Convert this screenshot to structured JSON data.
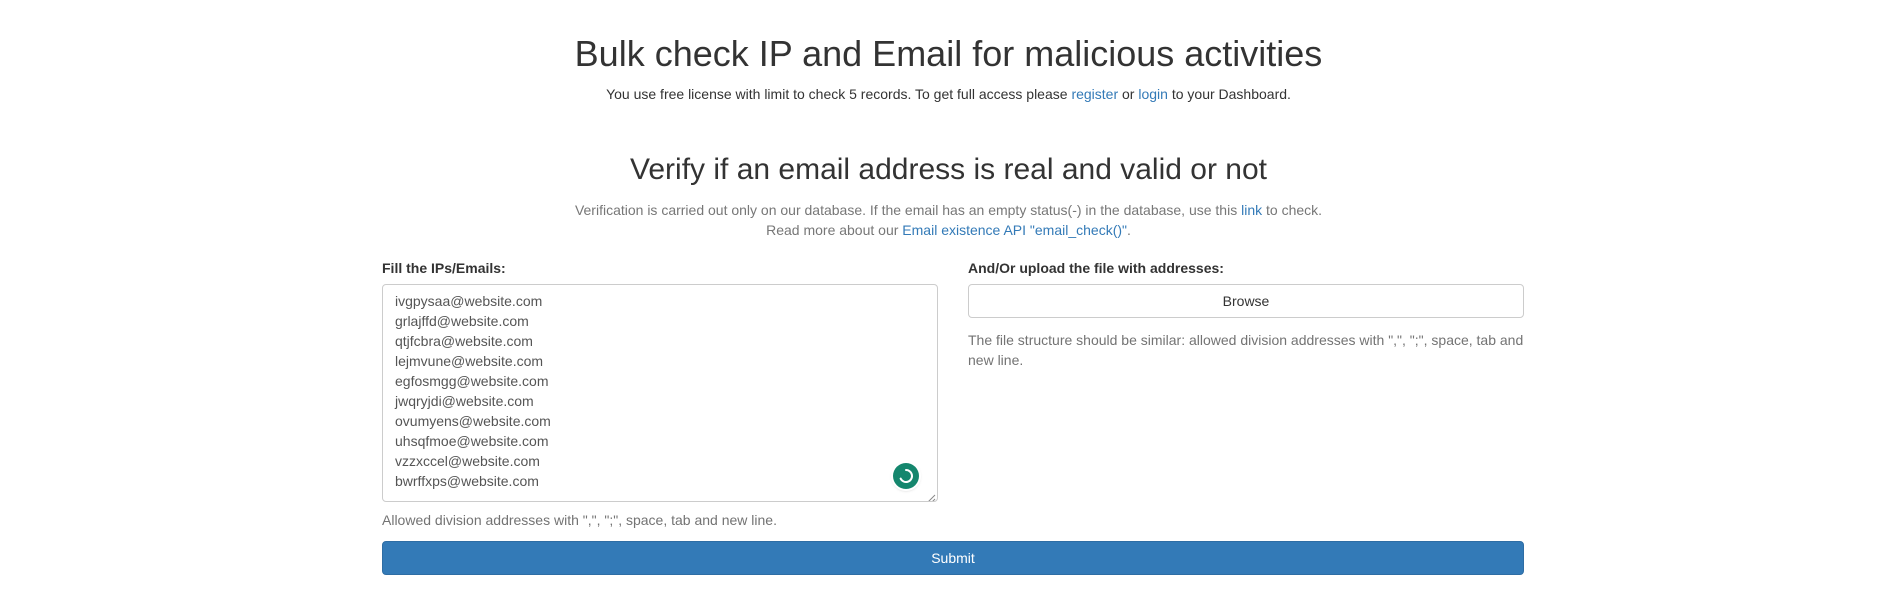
{
  "header": {
    "title": "Bulk check IP and Email for malicious activities",
    "license_prefix": "You use free license with limit to check 5 records. To get full access please ",
    "register_link": "register",
    "or_text": " or ",
    "login_link": "login",
    "license_suffix": " to your Dashboard."
  },
  "verify": {
    "title": "Verify if an email address is real and valid or not",
    "desc_prefix": "Verification is carried out only on our database. If the email has an empty status(-) in the database, use this ",
    "desc_link": "link",
    "desc_suffix": " to check.",
    "readmore_prefix": "Read more about our ",
    "api_link": "Email existence API \"email_check()\"",
    "readmore_suffix": "."
  },
  "form": {
    "left_label": "Fill the IPs/Emails:",
    "emails": [
      "ivgpysaa@website.com",
      "grlajffd@website.com",
      "qtjfcbra@website.com",
      "lejmvune@website.com",
      "egfosmgg@website.com",
      "jwqryjdi@website.com",
      "ovumyens@website.com",
      "uhsqfmoe@website.com",
      "vzzxccel@website.com",
      "bwrffxps@website.com"
    ],
    "left_help": "Allowed division addresses with \",\", \";\", space, tab and new line.",
    "right_label": "And/Or upload the file with addresses:",
    "browse_label": "Browse",
    "right_help": "The file structure should be similar: allowed division addresses with \",\", \";\", space, tab and new line.",
    "submit_label": "Submit"
  },
  "colors": {
    "link": "#337ab7",
    "primary_button": "#337ab7",
    "grammar_badge": "#14866d"
  },
  "icons": {
    "grammar_badge": "grammar-check-icon",
    "resize": "resize-grip-icon"
  }
}
